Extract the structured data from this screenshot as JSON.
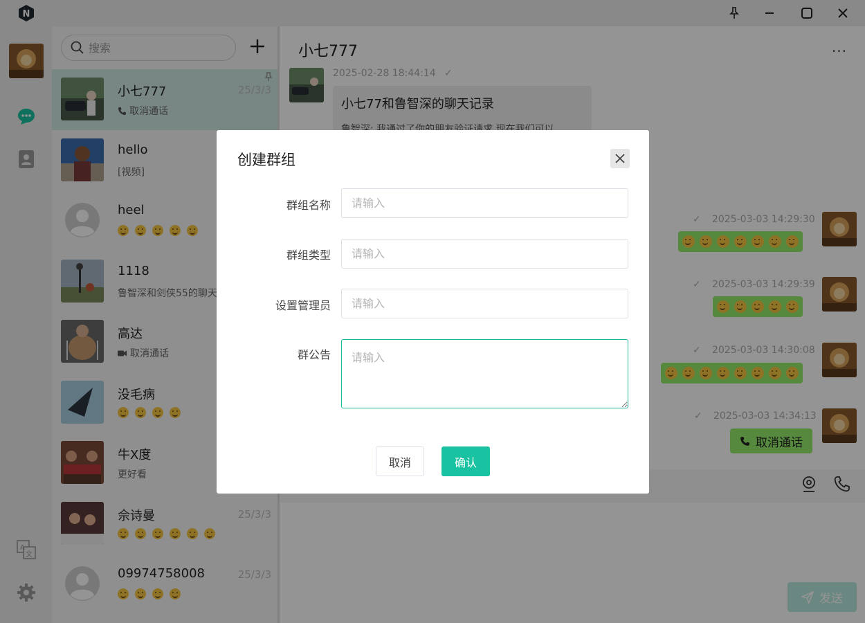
{
  "app": {
    "logo_letter": "N"
  },
  "search": {
    "placeholder": "搜索"
  },
  "contacts": [
    {
      "name": "小七777",
      "sub": "取消通话",
      "sub_icon": "phone-icon",
      "time": "25/3/3",
      "pinned": true,
      "active": true,
      "avatar": "photo-car"
    },
    {
      "name": "hello",
      "sub": "[视频]",
      "time": "",
      "avatar": "photo-person"
    },
    {
      "name": "heel",
      "emojis": 5,
      "time": "",
      "avatar": "default-avatar"
    },
    {
      "name": "1118",
      "sub": "鲁智深和剑侠55的聊天",
      "time": "",
      "avatar": "photo-lamp"
    },
    {
      "name": "高达",
      "sub": "取消通话",
      "sub_icon": "video-icon",
      "time": "",
      "avatar": "photo-giant"
    },
    {
      "name": "没毛病",
      "emojis": 4,
      "time": "",
      "avatar": "photo-triangle"
    },
    {
      "name": "牛X度",
      "sub": "更好看",
      "time": "",
      "avatar": "photo-crowd"
    },
    {
      "name": "佘诗曼",
      "emojis": 6,
      "time": "25/3/3",
      "avatar": "photo-drama"
    },
    {
      "name": "09974758008",
      "emojis": 4,
      "time": "25/3/3",
      "avatar": "default-avatar"
    }
  ],
  "chat": {
    "title": "小七777",
    "more_label": "···",
    "card": {
      "time": "2025-02-28 18:44:14",
      "title": "小七77和鲁智深的聊天记录",
      "snippet": "鲁智深: 我通过了你的朋友验证请求,现在我们可以"
    },
    "messages": [
      {
        "time": "2025-03-03 14:29:30",
        "emojis": 7
      },
      {
        "time": "2025-03-03 14:29:39",
        "emojis": 5
      },
      {
        "time": "2025-03-03 14:30:08",
        "emojis": 8
      },
      {
        "time": "2025-03-03 14:34:13",
        "call_label": "取消通话"
      }
    ],
    "send_label": "发送"
  },
  "modal": {
    "title": "创建群组",
    "fields": [
      {
        "label": "群组名称",
        "placeholder": "请输入"
      },
      {
        "label": "群组类型",
        "placeholder": "请输入"
      },
      {
        "label": "设置管理员",
        "placeholder": "请输入"
      },
      {
        "label": "群公告",
        "placeholder": "请输入"
      }
    ],
    "cancel_label": "取消",
    "confirm_label": "确认"
  },
  "colors": {
    "accent": "#19c2a0",
    "bubble_green": "#95ec69",
    "active_row": "#cfe9e3"
  }
}
